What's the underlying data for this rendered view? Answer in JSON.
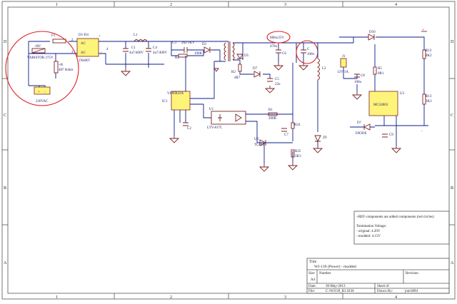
{
  "border": {
    "top_numbers": [
      "1",
      "2",
      "3",
      "4"
    ],
    "side_letters": [
      "D",
      "C",
      "B",
      "A"
    ]
  },
  "components": {
    "f1": "F1",
    "rv": "+RV",
    "varistor": "VARISTOR 275V",
    "r_top": "+R",
    "r_val": "487 0ohm",
    "d1d4": "D1-D4",
    "ac1": "AC",
    "ac2": "AC",
    "bridge_pn": "1N4007",
    "bridge_pin_plus": "+",
    "bridge_pin_minus": "-",
    "bridge_pin2": "2",
    "bridge_pin3": "3",
    "bridge_pin4": "4",
    "l1": "L1",
    "c1": "C1",
    "c1_val": "4u7/400V",
    "c4": "C4",
    "c4_val": "4u7/400V",
    "c3": "C3",
    "c3_val": "2n2/1KV",
    "r4": "R4",
    "r4_val": "100K",
    "d1": "D1",
    "d5": "D5",
    "r_small": "R2",
    "r_small_val": "4R7",
    "d7": "D7",
    "c5": "C5",
    "c5_val": "22u",
    "t1_val": "680u/25V",
    "c6": "C6",
    "c6_val": "470u",
    "c_new": "C",
    "c_new_val": "100n",
    "l2": "L2",
    "d10": "D10",
    "ic1_pn": "VIPER22A",
    "ic1": "IC1",
    "c2": "C2",
    "u1": "U1",
    "u1_pn": "LTV-817C",
    "r1": "R1",
    "r1_val": "200R",
    "u3": "U3",
    "u3_pn": "TL431",
    "c7": "C7",
    "r24": "R24",
    "r25": "R25",
    "r25_val": "3K3",
    "zener": "Z9",
    "r_top_right": "R",
    "jumper": "J1",
    "jumper_val": "12V/1A",
    "c8": "C8",
    "c8_val": "100u",
    "r5": "R5",
    "r5_val": "0R1",
    "u2": "U2",
    "u2_pn": "MC34063",
    "d_red": "D?",
    "d_red_pn": "DIODE",
    "r12": "R12",
    "r12_val": "8K2",
    "r13": "R13",
    "r13_val": "3K3",
    "c9": "C9",
    "pin_plus": "+",
    "pin_minus": "-",
    "ac_in": "230VAC"
  },
  "notes": {
    "line1": "+REF components are added components (red circles)",
    "line2": "Termination Voltage:",
    "line3": "- original: 4.20V",
    "line4": "- modded: 4.15V"
  },
  "title_block": {
    "title_label": "Title",
    "title": "WJ-139 (Power) - modded",
    "size_label": "Size",
    "size": "A4",
    "number_label": "Number",
    "revision_label": "Revision",
    "date_label": "Date:",
    "date": "30-May-2013",
    "sheet_label": "Sheet    of",
    "file_label": "File:",
    "file": "C:\\WJ139_B1.SCH",
    "drawn_label": "Drawn By:",
    "drawn": "jonr3894"
  },
  "colors": {
    "wire": "#0b1d8a",
    "component": "#7a2323",
    "ic_fill": "#fff47a",
    "highlight": "#e02020"
  }
}
